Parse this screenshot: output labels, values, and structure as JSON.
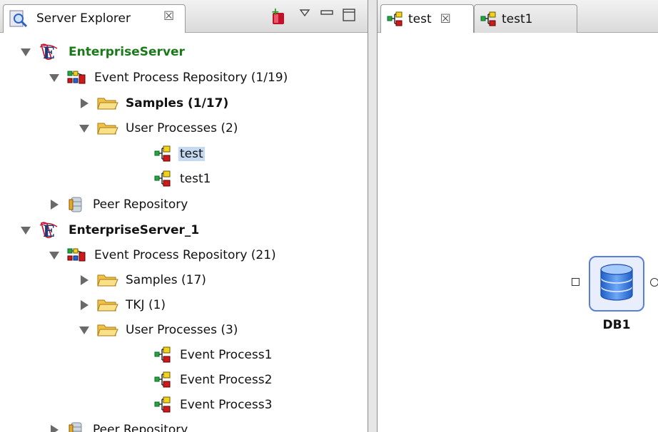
{
  "server_explorer": {
    "tab_title": "Server Explorer",
    "tab_close": "☒",
    "icons": [
      "server-explorer-icon",
      "new-server-icon",
      "view-menu-icon",
      "minimize-icon",
      "maximize-icon"
    ]
  },
  "tree": [
    {
      "label": "EnterpriseServer",
      "icon": "enterprise-server-icon",
      "expanded": true,
      "style": "green"
    },
    {
      "label": "Event Process Repository (1/19)",
      "icon": "repository-icon",
      "expanded": true
    },
    {
      "label": "Samples (1/17)",
      "icon": "folder-icon",
      "expanded": false,
      "style": "bold"
    },
    {
      "label": "User Processes (2)",
      "icon": "folder-icon",
      "expanded": true
    },
    {
      "label": "test",
      "icon": "event-process-icon",
      "selected": true
    },
    {
      "label": "test1",
      "icon": "event-process-icon"
    },
    {
      "label": "Peer Repository",
      "icon": "peer-repository-icon",
      "expanded": false
    },
    {
      "label": "EnterpriseServer_1",
      "icon": "enterprise-server-icon",
      "expanded": true,
      "style": "bold"
    },
    {
      "label": "Event Process Repository (21)",
      "icon": "repository-icon",
      "expanded": true
    },
    {
      "label": "Samples (17)",
      "icon": "folder-icon",
      "expanded": false
    },
    {
      "label": "TKJ (1)",
      "icon": "folder-icon",
      "expanded": false
    },
    {
      "label": "User Processes (3)",
      "icon": "folder-icon",
      "expanded": true
    },
    {
      "label": "Event Process1",
      "icon": "event-process-icon"
    },
    {
      "label": "Event Process2",
      "icon": "event-process-icon"
    },
    {
      "label": "Event Process3",
      "icon": "event-process-icon"
    },
    {
      "label": "Peer Repository",
      "icon": "peer-repository-icon",
      "expanded": false
    }
  ],
  "editor": {
    "tabs": [
      {
        "label": "test",
        "active": true,
        "close": "☒"
      },
      {
        "label": "test1",
        "active": false
      }
    ],
    "node": {
      "label": "DB1",
      "icon": "database-icon"
    }
  }
}
